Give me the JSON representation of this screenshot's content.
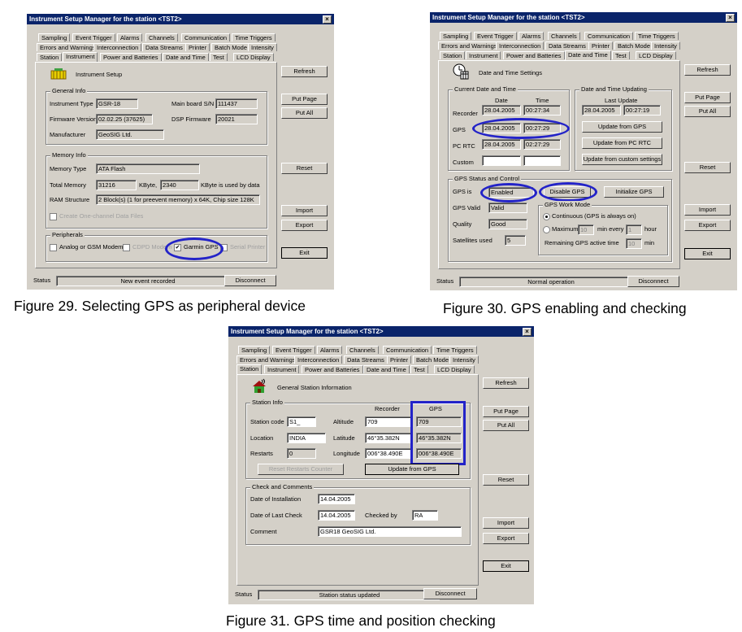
{
  "common": {
    "window_title": "Instrument Setup Manager for the station <TST2>",
    "close_glyph": "×",
    "tabs_row1": [
      "Sampling",
      "Event Trigger",
      "Alarms",
      "Channels",
      "Communication",
      "Time Triggers"
    ],
    "tabs_row2": [
      "Errors and Warnings",
      "Interconnection",
      "Data Streams",
      "Printer",
      "Batch Mode",
      "Intensity"
    ],
    "tabs_row3": [
      "Station",
      "Instrument",
      "Power and Batteries",
      "Date and Time",
      "Test",
      "LCD Display"
    ],
    "buttons": {
      "refresh": "Refresh",
      "put_page": "Put Page",
      "put_all": "Put All",
      "reset": "Reset",
      "import": "Import",
      "export": "Export",
      "exit": "Exit",
      "disconnect": "Disconnect"
    },
    "status_label": "Status"
  },
  "fig29": {
    "caption": "Figure 29. Selecting GPS as peripheral device",
    "header": "Instrument Setup",
    "general_info": {
      "title": "General Info",
      "instrument_type_label": "Instrument Type",
      "instrument_type": "GSR-18",
      "mainboard_label": "Main board S/N",
      "mainboard": "111437",
      "firmware_label": "Firmware Version",
      "firmware": "02.02.25 (37625)",
      "dsp_label": "DSP Firmware",
      "dsp": "20021",
      "manufacturer_label": "Manufacturer",
      "manufacturer": "GeoSIG Ltd."
    },
    "memory_info": {
      "title": "Memory Info",
      "type_label": "Memory Type",
      "type": "ATA Flash",
      "total_label": "Total Memory",
      "total": "31216",
      "kbyte": "KByte,",
      "used": "2340",
      "used_suffix": "KByte is used by data",
      "ram_label": "RAM Structure",
      "ram": "2 Block(s) (1 for preevent memory) x 64K, Chip size 128K",
      "one_channel": "Create One-channel Data Files"
    },
    "peripherals": {
      "title": "Peripherals",
      "analog": "Analog or GSM Modem",
      "cdpd": "CDPD Modem",
      "garmin": "Garmin GPS",
      "serial": "Serial Printer"
    },
    "status_text": "New event recorded"
  },
  "fig30": {
    "caption": "Figure 30. GPS enabling and checking",
    "header": "Date and Time Settings",
    "current": {
      "title": "Current Date and Time",
      "date_hdr": "Date",
      "time_hdr": "Time",
      "recorder_label": "Recorder",
      "recorder_date": "28.04.2005",
      "recorder_time": "00:27:34",
      "gps_label": "GPS",
      "gps_date": "28.04.2005",
      "gps_time": "00:27:29",
      "pcrtc_label": "PC RTC",
      "pcrtc_date": "28.04.2005",
      "pcrtc_time": "02:27:29",
      "custom_label": "Custom"
    },
    "updating": {
      "title": "Date and Time Updating",
      "last_update": "Last Update",
      "date": "28.04.2005",
      "time": "00:27:19",
      "from_gps": "Update from GPS",
      "from_pc": "Update from PC RTC",
      "from_custom": "Update from custom settings"
    },
    "gps": {
      "title": "GPS Status and Control",
      "gps_is_label": "GPS is",
      "gps_is": "Enabled",
      "disable": "Disable GPS",
      "initialize": "Initialize GPS",
      "valid_label": "GPS Valid",
      "valid": "Valid",
      "quality_label": "Quality",
      "quality": "Good",
      "sats_label": "Satellites used",
      "sats": "5",
      "mode_title": "GPS Work Mode",
      "continuous": "Continuous (GPS is always on)",
      "maximum": "Maximum",
      "max_val": "10",
      "min_every": "min every",
      "every_val": "1",
      "hour": "hour",
      "remaining": "Remaining GPS active time",
      "remaining_val": "10",
      "min": "min"
    },
    "status_text": "Normal operation"
  },
  "fig31": {
    "caption": "Figure 31. GPS time and position checking",
    "header": "General Station Information",
    "station_info": {
      "title": "Station Info",
      "recorder_hdr": "Recorder",
      "gps_hdr": "GPS",
      "code_label": "Station code",
      "code": "S1_",
      "altitude_label": "Altitude",
      "altitude_rec": "709",
      "altitude_gps": "709",
      "location_label": "Location",
      "location": "INDIA",
      "latitude_label": "Latitude",
      "latitude_rec": "46°35.382N",
      "latitude_gps": "46°35.382N",
      "restarts_label": "Restarts",
      "restarts": "0",
      "longitude_label": "Longitude",
      "longitude_rec": "006°38.490E",
      "longitude_gps": "006°38.490E",
      "reset_restarts": "Reset Restarts Counter",
      "update_gps": "Update from GPS"
    },
    "check": {
      "title": "Check and Comments",
      "install_label": "Date of Installation",
      "install": "14.04.2005",
      "lastcheck_label": "Date of Last Check",
      "lastcheck": "14.04.2005",
      "checked_by_label": "Checked by",
      "checked_by": "RA",
      "comment_label": "Comment",
      "comment": "GSR18 GeoSIG Ltd."
    },
    "status_text": "Station status updated"
  },
  "colors": {
    "dialog_bg": "#d4d0c8",
    "title_bg": "#0a246a",
    "highlight": "#2323c8"
  }
}
